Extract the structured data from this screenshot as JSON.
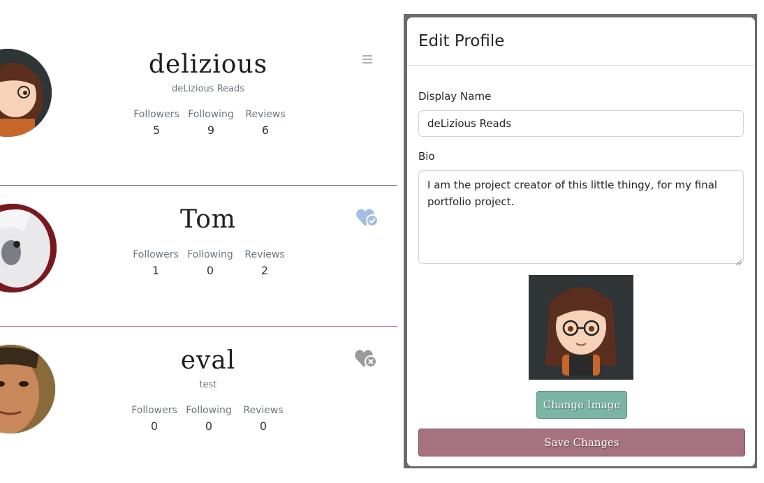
{
  "profiles": [
    {
      "username": "delizious",
      "display_name": "deLizious Reads",
      "stats": [
        {
          "label": "Followers",
          "value": "5"
        },
        {
          "label": "Following",
          "value": "9"
        },
        {
          "label": "Reviews",
          "value": "6"
        }
      ],
      "action_icon": "hamburger-menu-icon"
    },
    {
      "username": "Tom",
      "display_name": "",
      "stats": [
        {
          "label": "Followers",
          "value": "1"
        },
        {
          "label": "Following",
          "value": "0"
        },
        {
          "label": "Reviews",
          "value": "2"
        }
      ],
      "action_icon": "heart-check-icon"
    },
    {
      "username": "eval",
      "display_name": "test",
      "stats": [
        {
          "label": "Followers",
          "value": "0"
        },
        {
          "label": "Following",
          "value": "0"
        },
        {
          "label": "Reviews",
          "value": "0"
        }
      ],
      "action_icon": "heart-x-icon"
    }
  ],
  "modal": {
    "title": "Edit Profile",
    "display_name_label": "Display Name",
    "display_name_value": "deLizious Reads",
    "bio_label": "Bio",
    "bio_value": "I am the project creator of this little thingy, for my final portfolio project.",
    "change_image_label": "Change Image",
    "save_label": "Save Changes"
  },
  "colors": {
    "change_button": "#7bb5a4",
    "save_button": "#a7727f",
    "follow_heart": "#a5bde0",
    "unfollow_heart": "#9a9a9a",
    "divider_1": "#6c757d",
    "divider_2": "#c9636e"
  }
}
